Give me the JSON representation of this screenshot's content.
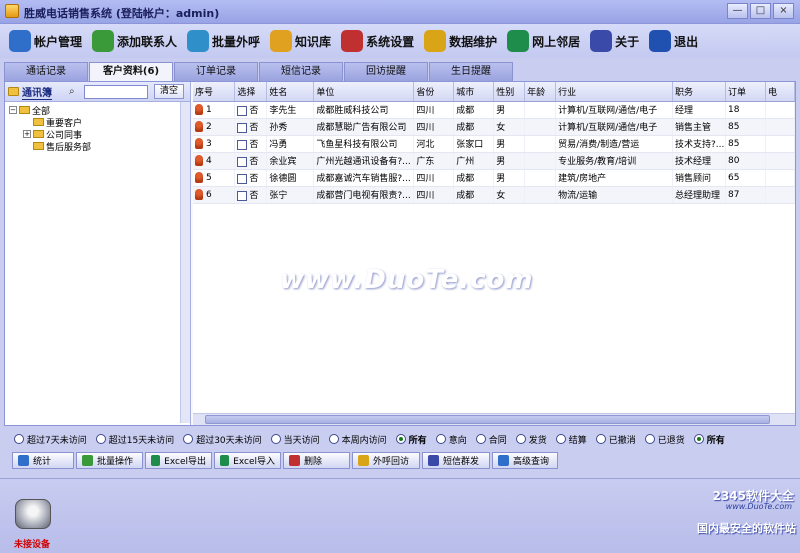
{
  "window": {
    "title": "胜威电话销售系统 (登陆帐户：admin)",
    "buttons": [
      "—",
      "□",
      "×"
    ]
  },
  "toolbar": [
    {
      "label": "帐户管理",
      "icon": "account-icon",
      "color": "#2f6fc9"
    },
    {
      "label": "添加联系人",
      "icon": "add-contact-icon",
      "color": "#3a9a3a"
    },
    {
      "label": "批量外呼",
      "icon": "batch-call-icon",
      "color": "#2f8fc9"
    },
    {
      "label": "知识库",
      "icon": "knowledge-icon",
      "color": "#e0a020"
    },
    {
      "label": "系统设置",
      "icon": "settings-icon",
      "color": "#c03030"
    },
    {
      "label": "数据维护",
      "icon": "data-icon",
      "color": "#d9a416"
    },
    {
      "label": "网上邻居",
      "icon": "network-icon",
      "color": "#1e8c4a"
    },
    {
      "label": "关于",
      "icon": "about-icon",
      "color": "#3a4aa8"
    },
    {
      "label": "退出",
      "icon": "exit-icon",
      "color": "#2050b0"
    }
  ],
  "tabs": [
    "通话记录",
    "客户资料(6)",
    "订单记录",
    "短信记录",
    "回访提醒",
    "生日提醒"
  ],
  "active_tab": 1,
  "sidebar": {
    "title": "通讯簿",
    "search_value": "",
    "clear_label": "清空",
    "tree": [
      {
        "label": "全部",
        "level": 0,
        "expander": "−"
      },
      {
        "label": "重要客户",
        "level": 1,
        "expander": ""
      },
      {
        "label": "公司同事",
        "level": 1,
        "expander": "+"
      },
      {
        "label": "售后服务部",
        "level": 1,
        "expander": ""
      }
    ]
  },
  "table": {
    "columns": [
      "序号",
      "选择",
      "姓名",
      "单位",
      "省份",
      "城市",
      "性别",
      "年龄",
      "行业",
      "职务",
      "订单",
      "电"
    ],
    "rows": [
      [
        "1",
        "否",
        "李先生",
        "成都胜威科技公司",
        "四川",
        "成都",
        "男",
        "",
        "计算机/互联网/通信/电子",
        "经理",
        "18"
      ],
      [
        "2",
        "否",
        "孙秀",
        "成都慧聪广告有限公司",
        "四川",
        "成都",
        "女",
        "",
        "计算机/互联网/通信/电子",
        "销售主管",
        "85"
      ],
      [
        "3",
        "否",
        "冯勇",
        "飞鱼星科技有限公司",
        "河北",
        "张家口",
        "男",
        "",
        "贸易/消费/制造/营运",
        "技术支持?...",
        "85"
      ],
      [
        "4",
        "否",
        "余业宾",
        "广州光越通讯设备有?...",
        "广东",
        "广州",
        "男",
        "",
        "专业服务/教育/培训",
        "技术经理",
        "80"
      ],
      [
        "5",
        "否",
        "徐德圆",
        "成都嘉诚汽车销售服?...",
        "四川",
        "成都",
        "男",
        "",
        "建筑/房地产",
        "销售顾问",
        "65"
      ],
      [
        "6",
        "否",
        "张宁",
        "成都营门电视有限责?...",
        "四川",
        "成都",
        "女",
        "",
        "物流/运输",
        "总经理助理",
        "87"
      ]
    ]
  },
  "filters": [
    {
      "label": "超过7天未访问",
      "checked": false
    },
    {
      "label": "超过15天未访问",
      "checked": false
    },
    {
      "label": "超过30天未访问",
      "checked": false
    },
    {
      "label": "当天访问",
      "checked": false
    },
    {
      "label": "本周内访问",
      "checked": false
    },
    {
      "label": "所有",
      "checked": true,
      "bold": true
    },
    {
      "label": "意向",
      "checked": false
    },
    {
      "label": "合同",
      "checked": false
    },
    {
      "label": "发货",
      "checked": false
    },
    {
      "label": "结算",
      "checked": false
    },
    {
      "label": "已撤消",
      "checked": false
    },
    {
      "label": "已退货",
      "checked": false
    },
    {
      "label": "所有",
      "checked": true,
      "bold": true
    }
  ],
  "actions": [
    {
      "label": "统计",
      "icon": "stats-icon",
      "color": "#2f6fc9"
    },
    {
      "label": "批量操作",
      "icon": "batch-icon",
      "color": "#3a9a3a"
    },
    {
      "label": "Excel导出",
      "icon": "excel-export-icon",
      "color": "#1e8c4a"
    },
    {
      "label": "Excel导入",
      "icon": "excel-import-icon",
      "color": "#1e8c4a"
    },
    {
      "label": "删除",
      "icon": "delete-icon",
      "color": "#c03030"
    },
    {
      "label": "外呼回访",
      "icon": "callback-icon",
      "color": "#d9a416"
    },
    {
      "label": "短信群发",
      "icon": "sms-icon",
      "color": "#3a4aa8"
    },
    {
      "label": "高级查询",
      "icon": "query-icon",
      "color": "#2f6fc9"
    }
  ],
  "status": {
    "device_label": "未接设备"
  },
  "watermark": "www.DuoTe.com",
  "badge": {
    "logo": "2345软件大全",
    "url": "www.DuoTe.com",
    "subtitle": "国内最安全的软件站"
  }
}
